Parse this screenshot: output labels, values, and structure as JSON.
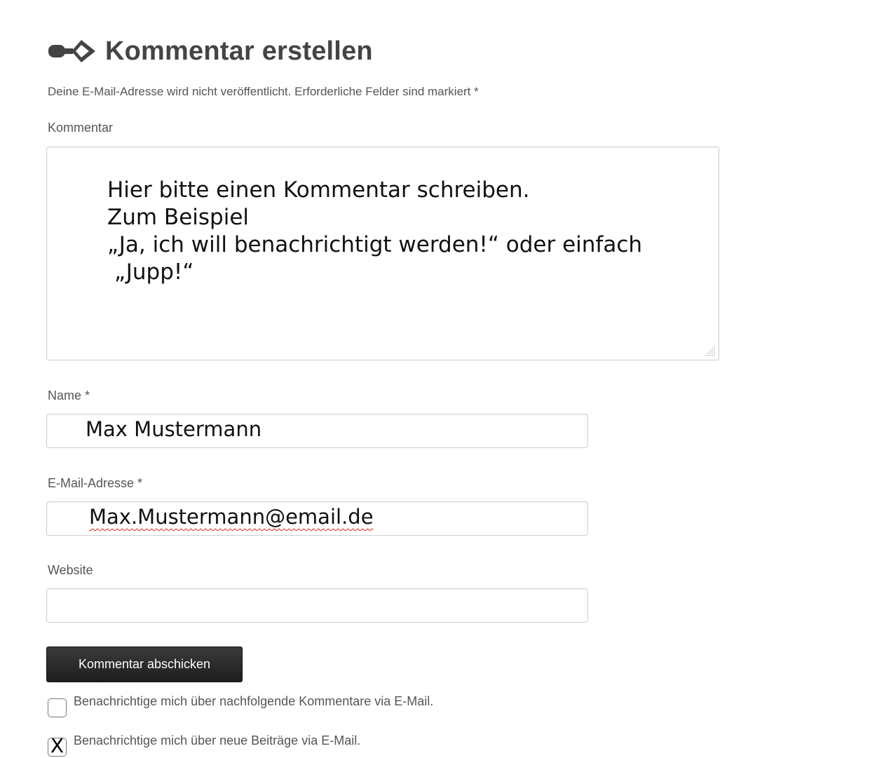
{
  "heading": {
    "icon": "key-arrow-icon",
    "title": "Kommentar erstellen"
  },
  "notes": "Deine E-Mail-Adresse wird nicht veröffentlicht. Erforderliche Felder sind markiert *",
  "comment": {
    "label": "Kommentar",
    "lines": [
      "Hier bitte einen Kommentar schreiben.",
      "Zum Beispiel",
      "„Ja, ich will benachrichtigt werden!“ oder einfach",
      "„Jupp!“"
    ]
  },
  "name": {
    "label": "Name *",
    "value": "Max Mustermann"
  },
  "email": {
    "label": "E-Mail-Adresse *",
    "value": "Max.Mustermann@email.de"
  },
  "website": {
    "label": "Website",
    "value": ""
  },
  "submit": {
    "label": "Kommentar abschicken"
  },
  "subscriptions": [
    {
      "label": "Benachrichtige mich über nachfolgende Kommentare via E-Mail.",
      "mark": ""
    },
    {
      "label": "Benachrichtige mich über neue Beiträge via E-Mail.",
      "mark": "X"
    }
  ],
  "colors": {
    "button_bg": "#222222",
    "text": "#555555",
    "border": "#cfcfcf",
    "spellcheck": "#e02020"
  }
}
